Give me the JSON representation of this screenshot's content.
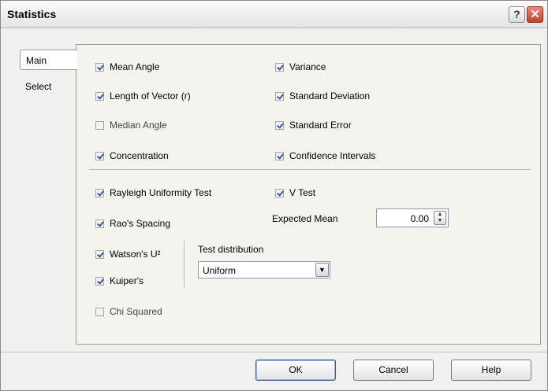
{
  "window": {
    "title": "Statistics",
    "help_glyph": "?",
    "close_glyph": "✕"
  },
  "tabs": [
    {
      "label": "Main"
    },
    {
      "label": "Select"
    }
  ],
  "descriptive": {
    "mean_angle": {
      "label": "Mean Angle",
      "checked": true
    },
    "length_of_vector": {
      "label": "Length of Vector (r)",
      "checked": true
    },
    "median_angle": {
      "label": "Median Angle",
      "checked": false
    },
    "concentration": {
      "label": "Concentration",
      "checked": true
    },
    "variance": {
      "label": "Variance",
      "checked": true
    },
    "standard_deviation": {
      "label": "Standard Deviation",
      "checked": true
    },
    "standard_error": {
      "label": "Standard Error",
      "checked": true
    },
    "confidence_intervals": {
      "label": "Confidence Intervals",
      "checked": true
    }
  },
  "tests": {
    "rayleigh": {
      "label": "Rayleigh Uniformity Test",
      "checked": true
    },
    "raos_spacing": {
      "label": "Rao's Spacing",
      "checked": true
    },
    "watsons_u2": {
      "label": "Watson's U²",
      "checked": true
    },
    "kuipers": {
      "label": "Kuiper's",
      "checked": true
    },
    "chi_squared": {
      "label": "Chi Squared",
      "checked": false
    },
    "v_test": {
      "label": "V Test",
      "checked": true
    },
    "expected_mean_label": "Expected Mean",
    "expected_mean_value": "0.00",
    "test_distribution_label": "Test distribution",
    "test_distribution_value": "Uniform"
  },
  "buttons": {
    "ok": "OK",
    "cancel": "Cancel",
    "help": "Help"
  }
}
